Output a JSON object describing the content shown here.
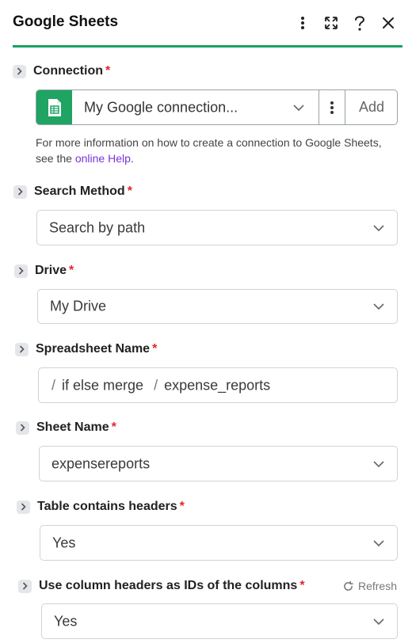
{
  "header": {
    "title": "Google Sheets",
    "icons": [
      "more-vertical-icon",
      "expand-icon",
      "help-icon",
      "close-icon"
    ],
    "accent_color": "#1aa260"
  },
  "connection": {
    "label": "Connection",
    "required_mark": "*",
    "value": "My Google connection...",
    "add_label": "Add",
    "help_prefix": "For more information on how to create a connection to Google Sheets, see the ",
    "help_link": "online Help",
    "help_suffix": "."
  },
  "search_method": {
    "label": "Search Method",
    "required_mark": "*",
    "value": "Search by path"
  },
  "drive": {
    "label": "Drive",
    "required_mark": "*",
    "value": "My Drive"
  },
  "spreadsheet": {
    "label": "Spreadsheet Name",
    "required_mark": "*",
    "path": [
      "if else merge",
      "expense_reports"
    ],
    "separator": "/"
  },
  "sheet": {
    "label": "Sheet Name",
    "required_mark": "*",
    "value": "expensereports"
  },
  "headers": {
    "label": "Table contains headers",
    "required_mark": "*",
    "value": "Yes"
  },
  "column_ids": {
    "label": "Use column headers as IDs of the columns",
    "required_mark": "*",
    "value": "Yes",
    "refresh_label": "Refresh"
  }
}
